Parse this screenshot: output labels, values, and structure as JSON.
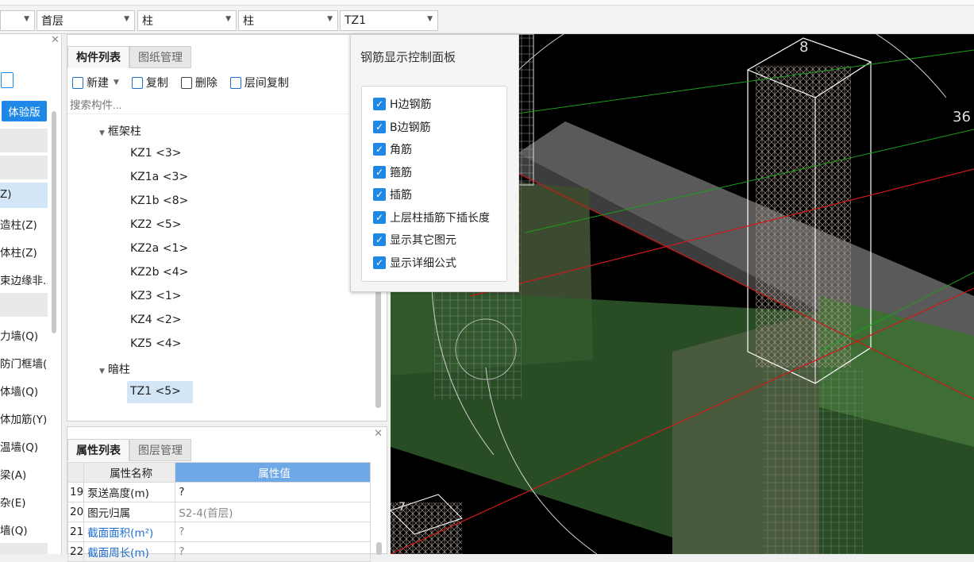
{
  "toolbar": {
    "dropdowns": [
      {
        "value": ""
      },
      {
        "value": "首层"
      },
      {
        "value": "柱"
      },
      {
        "value": "柱"
      },
      {
        "value": "TZ1"
      }
    ]
  },
  "left_panel": {
    "trial_label": "体验版",
    "items": [
      "Z)",
      "造柱(Z)",
      "体柱(Z)",
      "束边缘非..",
      "力墙(Q)",
      "防门框墙(.",
      "体墙(Q)",
      "体加筋(Y)",
      "温墙(Q)",
      "梁(A)",
      "杂(E)",
      "墙(Q)"
    ]
  },
  "component_panel": {
    "tabs": [
      "构件列表",
      "图纸管理"
    ],
    "actions": [
      "新建",
      "复制",
      "删除",
      "层间复制"
    ],
    "search_placeholder": "搜索构件...",
    "groups": [
      {
        "name": "框架柱",
        "items": [
          "KZ1 <3>",
          "KZ1a <3>",
          "KZ1b <8>",
          "KZ2 <5>",
          "KZ2a <1>",
          "KZ2b <4>",
          "KZ3 <1>",
          "KZ4 <2>",
          "KZ5 <4>"
        ]
      },
      {
        "name": "暗柱",
        "items": [
          "TZ1 <5>"
        ]
      }
    ]
  },
  "property_panel": {
    "tabs": [
      "属性列表",
      "图层管理"
    ],
    "columns": [
      "属性名称",
      "属性值"
    ],
    "rows": [
      {
        "num": "19",
        "name": "泵送高度(m)",
        "value": "?"
      },
      {
        "num": "20",
        "name": "图元归属",
        "value": "S2-4(首层)"
      },
      {
        "num": "21",
        "name": "截面面积(m²)",
        "value": "?"
      },
      {
        "num": "22",
        "name": "截面周长(m)",
        "value": "?"
      }
    ]
  },
  "rebar_popup": {
    "title": "钢筋显示控制面板",
    "options": [
      {
        "label": "H边钢筋",
        "checked": true
      },
      {
        "label": "B边钢筋",
        "checked": true
      },
      {
        "label": "角筋",
        "checked": true
      },
      {
        "label": "箍筋",
        "checked": true
      },
      {
        "label": "插筋",
        "checked": true
      },
      {
        "label": "上层柱插筋下插长度",
        "checked": true
      },
      {
        "label": "显示其它图元",
        "checked": true
      },
      {
        "label": "显示详细公式",
        "checked": true
      }
    ]
  },
  "viewport": {
    "labels": [
      "8",
      "36",
      "7"
    ]
  },
  "colors": {
    "accent": "#1f87e6",
    "selection": "#d3e6f7",
    "header_blue": "#6ea8e6",
    "viewport_bg": "#000000"
  }
}
